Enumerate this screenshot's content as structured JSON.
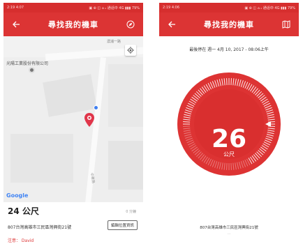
{
  "left_screen": {
    "status_time": "2:19 4:07",
    "status_icons": "▣ ⊕ ◫ ⌂ ᵢₗ 通话中 4G ▮▮▮ 79%",
    "title": "尋找我的機車",
    "back_icon": "back-arrow-icon",
    "compass_icon": "compass-icon",
    "map": {
      "poi_label": "光陽工業股份有限公司",
      "street_top": "濃浦一路",
      "street_bottom": "中華路",
      "google": "Google"
    },
    "distance": "24 公尺",
    "time_ago": "0 分鐘",
    "address": "807台灣高雄市三民區灣興街21號",
    "edit_button": "編輯位置資訊",
    "note": "注意： David"
  },
  "right_screen": {
    "status_time": "2:19 4:06",
    "status_icons": "▣ ⊕ ◫ ⌂ ᵢₗ 通话中 4G ▮▮▮ 79%",
    "title": "尋找我的機車",
    "back_icon": "back-arrow-icon",
    "map_icon": "map-icon",
    "parked_at": "最後停在 週一 4月 10, 2017 - 08:06上午",
    "gauge_value": "26",
    "gauge_unit": "公尺",
    "address": "807台灣高雄市三民區灣興街21號",
    "sub": "…"
  },
  "colors": {
    "brand_red": "#dc3434",
    "status_red": "#d62e2e"
  }
}
